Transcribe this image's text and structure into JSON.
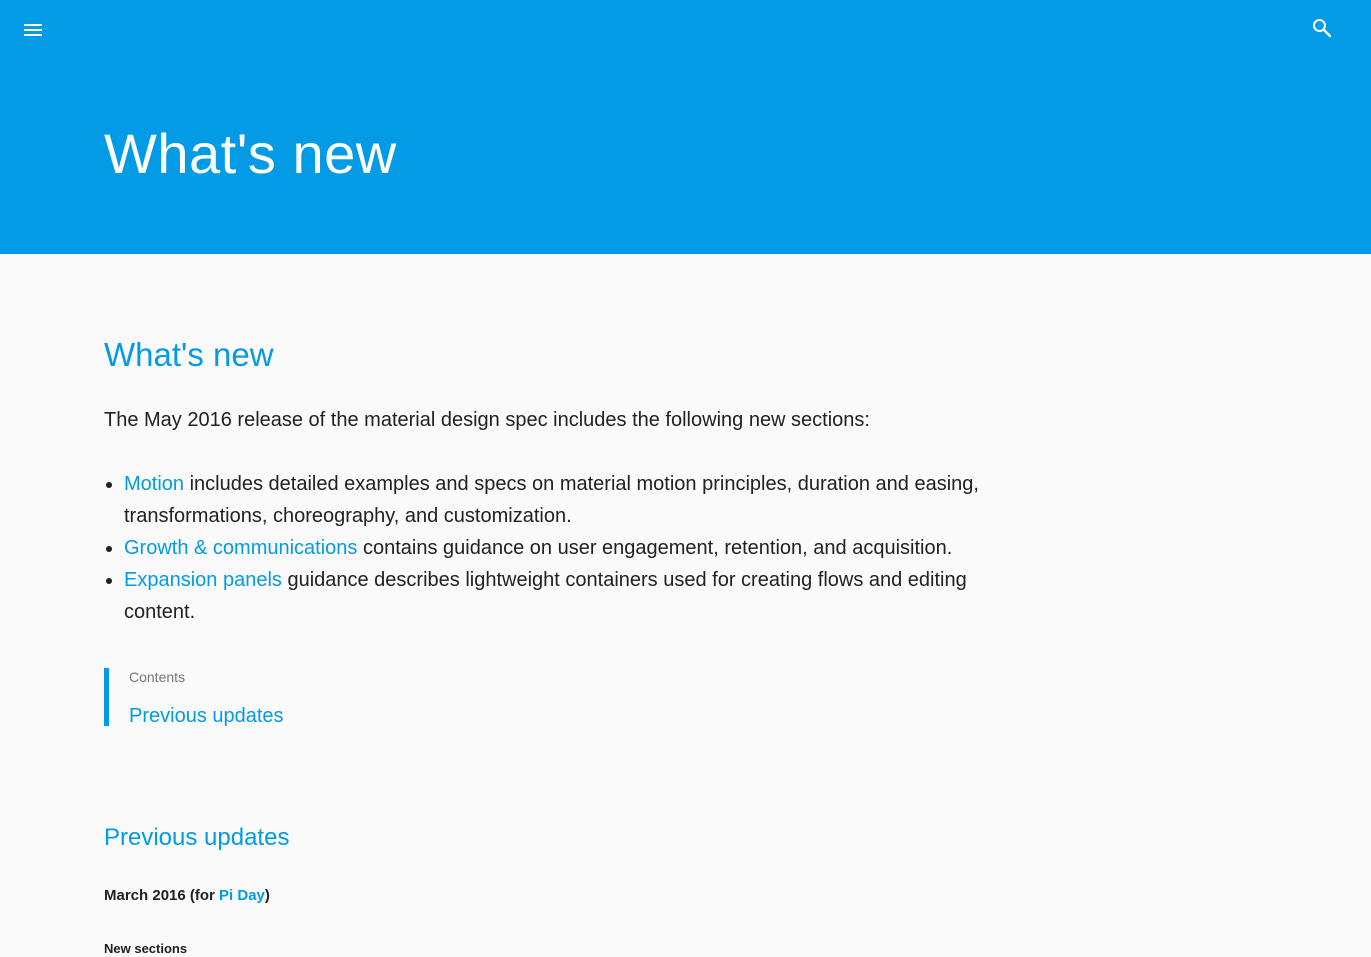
{
  "header": {
    "menu_icon": "menu-icon",
    "search_icon": "search-icon",
    "title": "What's new",
    "background_color": "#039be5"
  },
  "main": {
    "section_title": "What's new",
    "intro": "The May 2016 release of the material design spec includes the following new sections:",
    "bullets": [
      {
        "link": "Motion",
        "text": " includes detailed examples and specs on material motion principles, duration and easing, transformations, choreography, and customization."
      },
      {
        "link": "Growth & communications",
        "text": " contains guidance on user engagement, retention, and acquisition."
      },
      {
        "link": "Expansion panels",
        "text": " guidance describes lightweight containers used for creating flows and editing content."
      }
    ],
    "contents": {
      "label": "Contents",
      "link": "Previous updates"
    },
    "previous_updates": {
      "title": "Previous updates",
      "date_prefix": "March 2016 (for ",
      "date_link": "Pi Day",
      "date_suffix": ")",
      "new_sections_label": "New sections"
    }
  },
  "colors": {
    "accent": "#039be5",
    "text": "#212121",
    "muted": "#757575",
    "background": "#fafafa"
  }
}
